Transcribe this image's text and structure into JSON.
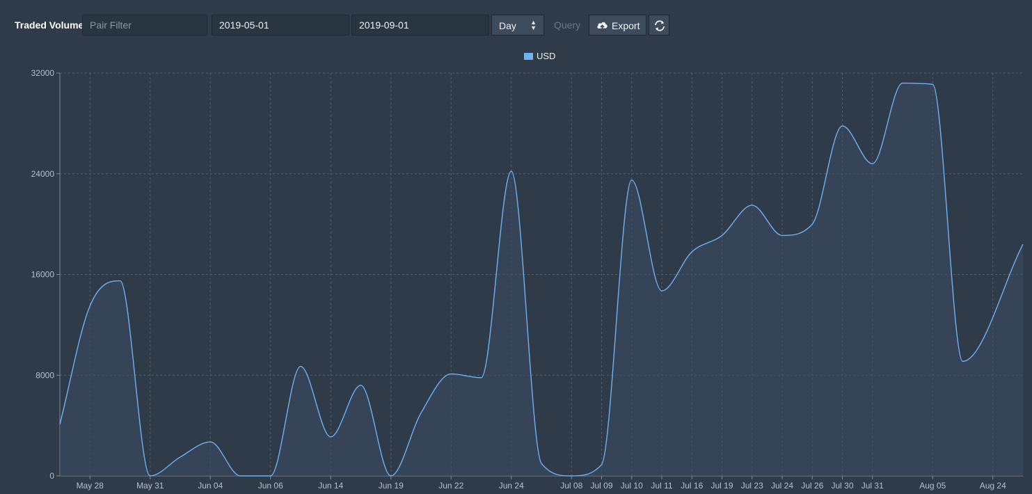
{
  "toolbar": {
    "title": "Traded Volume",
    "pair_filter_placeholder": "Pair Filter",
    "start_date": "2019-05-01",
    "end_date": "2019-09-01",
    "period": "Day",
    "query_label": "Query",
    "export_label": "Export"
  },
  "icons": {
    "export": "cloud-upload-icon",
    "refresh": "refresh-icon",
    "select": "sort-arrows-icon"
  },
  "colors": {
    "series_line": "#6fb2f2",
    "series_fill": "#3a4d62",
    "background": "#2f3b49"
  },
  "chart_data": {
    "type": "area",
    "legend_position": "top-center",
    "grid": true,
    "ylim": [
      0,
      32000
    ],
    "yticks": [
      0,
      8000,
      16000,
      24000,
      32000
    ],
    "xticks": [
      "May 28",
      "May 31",
      "Jun 04",
      "Jun 06",
      "Jun 14",
      "Jun 19",
      "Jun 22",
      "Jun 24",
      "Jul 08",
      "Jul 09",
      "Jul 10",
      "Jul 11",
      "Jul 16",
      "Jul 19",
      "Jul 23",
      "Jul 24",
      "Jul 26",
      "Jul 30",
      "Jul 31",
      "Aug 05",
      "Aug 24"
    ],
    "series": [
      {
        "name": "USD",
        "points": [
          {
            "x": "May 27",
            "y": 4100
          },
          {
            "x": "May 28",
            "y": 13500
          },
          {
            "x": "May 29",
            "y": 15500
          },
          {
            "x": "May 31",
            "y": 0
          },
          {
            "x": "Jun 03",
            "y": 1500
          },
          {
            "x": "Jun 04",
            "y": 2700
          },
          {
            "x": "Jun 05",
            "y": 0
          },
          {
            "x": "Jun 06",
            "y": 0
          },
          {
            "x": "Jun 07",
            "y": 8700
          },
          {
            "x": "Jun 14",
            "y": 3100
          },
          {
            "x": "Jun 16",
            "y": 7200
          },
          {
            "x": "Jun 19",
            "y": 0
          },
          {
            "x": "Jun 20",
            "y": 5000
          },
          {
            "x": "Jun 22",
            "y": 8100
          },
          {
            "x": "Jun 23",
            "y": 7800
          },
          {
            "x": "Jun 24",
            "y": 24200
          },
          {
            "x": "Jun 25",
            "y": 1000
          },
          {
            "x": "Jul 08",
            "y": 0
          },
          {
            "x": "Jul 09",
            "y": 900
          },
          {
            "x": "Jul 10",
            "y": 23500
          },
          {
            "x": "Jul 11",
            "y": 14700
          },
          {
            "x": "Jul 16",
            "y": 17800
          },
          {
            "x": "Jul 19",
            "y": 19100
          },
          {
            "x": "Jul 23",
            "y": 21500
          },
          {
            "x": "Jul 24",
            "y": 19100
          },
          {
            "x": "Jul 26",
            "y": 20000
          },
          {
            "x": "Jul 30",
            "y": 27800
          },
          {
            "x": "Jul 31",
            "y": 24800
          },
          {
            "x": "Aug 01",
            "y": 31200
          },
          {
            "x": "Aug 05",
            "y": 31100
          },
          {
            "x": "Aug 23",
            "y": 9100
          },
          {
            "x": "Aug 25",
            "y": 18400
          }
        ]
      }
    ]
  }
}
